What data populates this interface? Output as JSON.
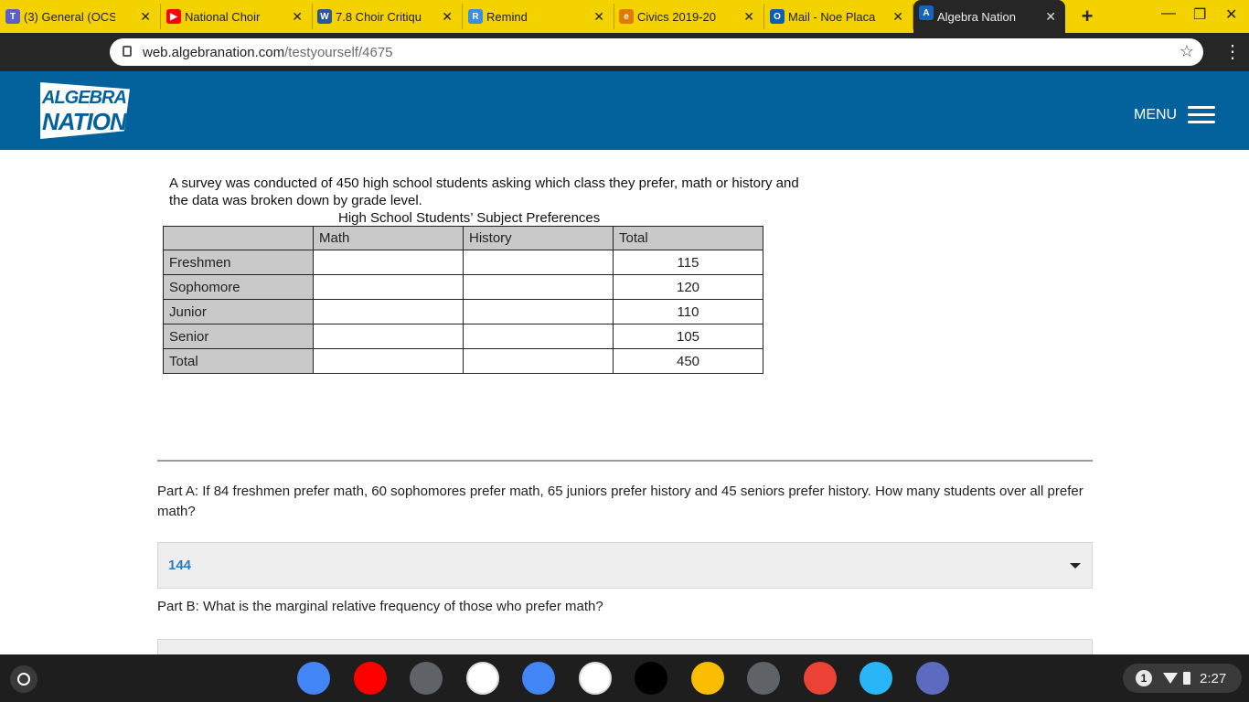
{
  "browser": {
    "tabs": [
      {
        "title": "(3) General (OCS",
        "icon": "teams-icon",
        "color": "#5b5fc7",
        "glyph": "T"
      },
      {
        "title": "National Choir",
        "icon": "youtube-icon",
        "color": "#ff0000",
        "glyph": "▶"
      },
      {
        "title": "7.8 Choir Critiqu",
        "icon": "word-icon",
        "color": "#2b579a",
        "glyph": "W"
      },
      {
        "title": "Remind",
        "icon": "remind-icon",
        "color": "#3a8ee6",
        "glyph": "R"
      },
      {
        "title": "Civics 2019-20",
        "icon": "edpuzzle-icon",
        "color": "#e07b00",
        "glyph": "e"
      },
      {
        "title": "Mail - Noe Placa",
        "icon": "outlook-icon",
        "color": "#0a5fb4",
        "glyph": "O"
      },
      {
        "title": "Algebra Nation",
        "icon": "algebra-nation-icon",
        "color": "#1565c0",
        "glyph": "A"
      }
    ],
    "url_domain": "web.algebranation.com",
    "url_path": "/testyourself/4675"
  },
  "header": {
    "logo_line1": "ALGEBRA",
    "logo_line2": "NATION",
    "menu_label": "MENU"
  },
  "question": {
    "intro": "A survey was conducted of 450 high school students asking which class they prefer, math or history and the data was broken down by grade level.",
    "table_title": "High School Students’ Subject Preferences",
    "columns": [
      "",
      "Math",
      "History",
      "Total"
    ],
    "rows": [
      {
        "label": "Freshmen",
        "math": "",
        "history": "",
        "total": "115"
      },
      {
        "label": "Sophomore",
        "math": "",
        "history": "",
        "total": "120"
      },
      {
        "label": "Junior",
        "math": "",
        "history": "",
        "total": "110"
      },
      {
        "label": "Senior",
        "math": "",
        "history": "",
        "total": "105"
      },
      {
        "label": "Total",
        "math": "",
        "history": "",
        "total": "450"
      }
    ],
    "part_a": "Part A: If 84 freshmen prefer math, 60 sophomores prefer math, 65 juniors prefer history and 45 seniors prefer history. How many students over all prefer math?",
    "part_a_answer": "144",
    "part_b": "Part B: What is the marginal relative frequency of those who prefer math?"
  },
  "shelf": {
    "apps": [
      {
        "name": "chrome-icon",
        "color": "#4285f4"
      },
      {
        "name": "youtube-icon",
        "color": "#ff0000"
      },
      {
        "name": "calculator-icon",
        "color": "#5f6368"
      },
      {
        "name": "play-store-icon",
        "color": "#ffffff"
      },
      {
        "name": "settings-icon",
        "color": "#4285f4"
      },
      {
        "name": "classroom-leaf-icon",
        "color": "#ffffff"
      },
      {
        "name": "screencastify-icon",
        "color": "#000000"
      },
      {
        "name": "photos-icon",
        "color": "#fbbc04"
      },
      {
        "name": "camera-icon",
        "color": "#5f6368"
      },
      {
        "name": "gmail-icon",
        "color": "#ea4335"
      },
      {
        "name": "cloud-icon",
        "color": "#29b6f6"
      },
      {
        "name": "keyboard-app-icon",
        "color": "#5c6bc0"
      }
    ],
    "notification_count": "1",
    "time": "2:27"
  }
}
